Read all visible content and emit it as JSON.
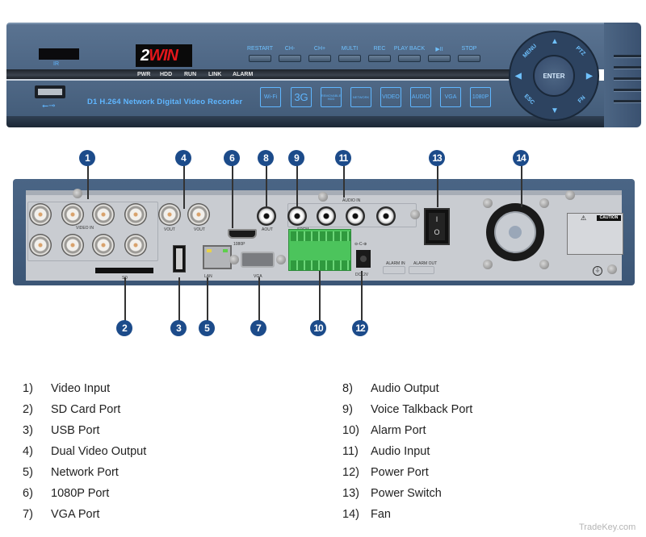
{
  "front_panel": {
    "ir_label": "IR",
    "logo": {
      "prefix": "2",
      "name": "WIN"
    },
    "leds": [
      "PWR",
      "HDD",
      "RUN",
      "LINK",
      "ALARM"
    ],
    "buttons": [
      "RESTART",
      "CH-",
      "CH+",
      "MULTI",
      "REC",
      "PLAY BACK",
      "▶II",
      "STOP"
    ],
    "usb_symbol": "⭠⊸",
    "model_text": "D1 H.264 Network Digital Video Recorder",
    "features": [
      "Wi-Fi",
      "3G",
      "REMOVABLE HDD",
      "NETWORK",
      "VIDEO",
      "AUDIO",
      "VGA",
      "1080P"
    ],
    "dial": {
      "center": "ENTER",
      "up": "▲",
      "down": "▼",
      "left": "◀",
      "right": "▶",
      "menu": "MENU",
      "ptz": "PTZ",
      "esc": "ESC",
      "fn": "FN"
    }
  },
  "rear_panel": {
    "video_in_label": "VIDEO IN",
    "vout_labels": [
      "VOUT",
      "VOUT"
    ],
    "hdmi_label": "1080P",
    "aout_label": "AOUT",
    "spcm_label": "SPCM",
    "audio_in_label": "AUDIO IN",
    "sd_label": "SD",
    "lan_label": "LAN",
    "vga_label": "VGA",
    "dc_label": "DC12V",
    "dc_polarity": "⊖-C-⊕",
    "caution_label": "CAUTION",
    "switch_marks": [
      "I",
      "O"
    ],
    "alarm_in_label": "ALARM IN",
    "alarm_out_label": "ALARM OUT",
    "ground_symbol": "⏚"
  },
  "callouts": [
    "1",
    "2",
    "3",
    "4",
    "5",
    "6",
    "7",
    "8",
    "9",
    "10",
    "11",
    "12",
    "13",
    "14"
  ],
  "legend": [
    {
      "num": "1)",
      "text": "Video Input"
    },
    {
      "num": "2)",
      "text": "SD Card Port"
    },
    {
      "num": "3)",
      "text": "USB Port"
    },
    {
      "num": "4)",
      "text": "Dual Video Output"
    },
    {
      "num": "5)",
      "text": "Network Port"
    },
    {
      "num": "6)",
      "text": "1080P Port"
    },
    {
      "num": "7)",
      "text": "VGA Port"
    },
    {
      "num": "8)",
      "text": "Audio Output"
    },
    {
      "num": "9)",
      "text": "Voice Talkback Port"
    },
    {
      "num": "10)",
      "text": "Alarm Port"
    },
    {
      "num": "11)",
      "text": "Audio Input"
    },
    {
      "num": "12)",
      "text": "Power Port"
    },
    {
      "num": "13)",
      "text": "Power Switch"
    },
    {
      "num": "14)",
      "text": "Fan"
    }
  ],
  "watermark": "TradeKey.com",
  "colors": {
    "callout": "#1c4b8a",
    "panel_blue": "#4d6684",
    "accent_cyan": "#5fb6ff",
    "logo_red": "#e3161b"
  }
}
